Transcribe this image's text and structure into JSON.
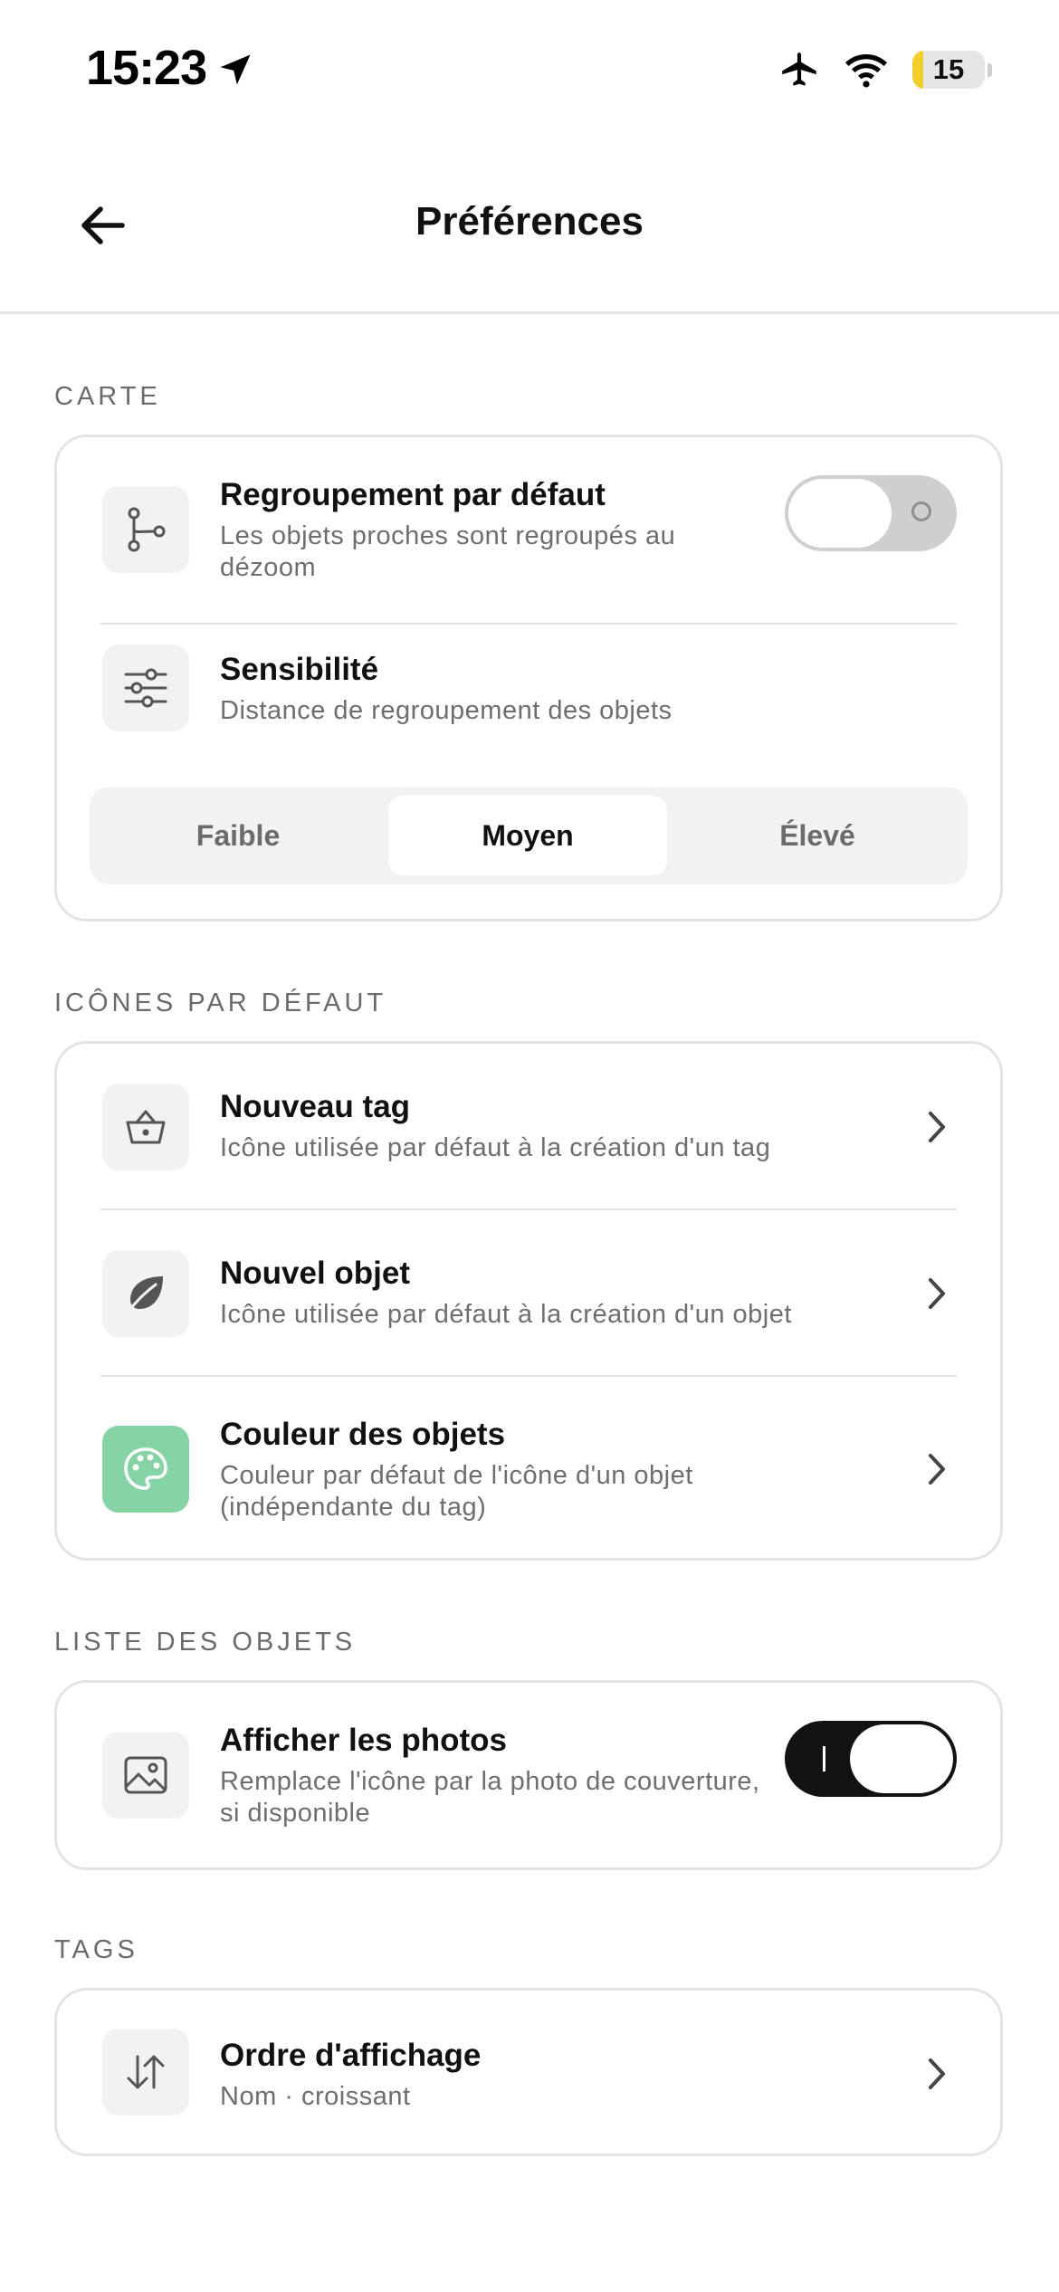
{
  "status_bar": {
    "time": "15:23",
    "battery_level": "15",
    "battery_fraction": 0.15,
    "location_icon": "location-arrow-icon",
    "airplane_icon": "airplane-icon",
    "wifi_icon": "wifi-icon"
  },
  "header": {
    "back_icon": "arrow-left-icon",
    "title": "Préférences"
  },
  "sections": {
    "carte": {
      "title": "CARTE",
      "grouping": {
        "icon": "branch-icon",
        "title": "Regroupement par défaut",
        "subtitle": "Les objets proches sont regroupés au dézoom",
        "enabled": false
      },
      "sensitivity": {
        "icon": "sliders-icon",
        "title": "Sensibilité",
        "subtitle": "Distance de regroupement des objets",
        "options": [
          "Faible",
          "Moyen",
          "Élevé"
        ],
        "selected": "Moyen"
      }
    },
    "icones": {
      "title": "ICÔNES PAR DÉFAUT",
      "items": [
        {
          "icon": "basket-icon",
          "title": "Nouveau tag",
          "subtitle": "Icône utilisée par défaut à la création d'un tag"
        },
        {
          "icon": "leaf-icon",
          "title": "Nouvel objet",
          "subtitle": "Icône utilisée par défaut à la création d'un objet"
        },
        {
          "icon": "palette-icon",
          "title": "Couleur des objets",
          "subtitle": "Couleur par défaut de l'icône d'un objet (indépendante du tag)",
          "color": "#86d3a5"
        }
      ]
    },
    "liste": {
      "title": "LISTE DES OBJETS",
      "photos": {
        "icon": "image-icon",
        "title": "Afficher les photos",
        "subtitle": "Remplace l'icône par la photo de couverture, si disponible",
        "enabled": true
      }
    },
    "tags": {
      "title": "TAGS",
      "order": {
        "icon": "sort-arrows-icon",
        "title": "Ordre d'affichage",
        "subtitle": "Nom · croissant"
      }
    }
  },
  "colors": {
    "accent_dark": "#121212",
    "toggle_off": "#cfcfcf",
    "palette_green": "#86d3a5",
    "battery_yellow": "#f2cf2c"
  }
}
